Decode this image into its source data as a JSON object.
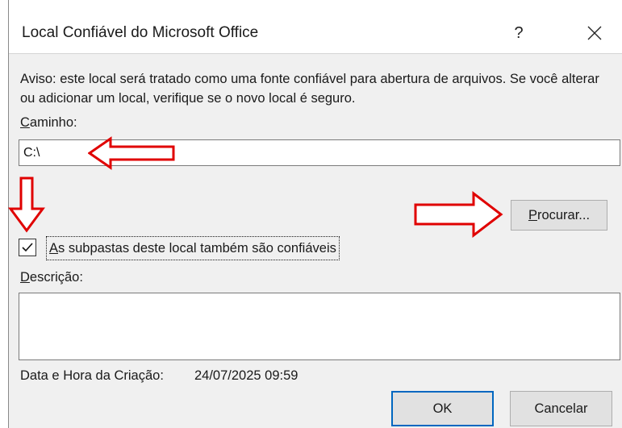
{
  "window": {
    "title": "Local Confiável do Microsoft Office",
    "help_label": "?",
    "close_icon": "close-icon"
  },
  "warning": {
    "text": "Aviso: este local será tratado como uma fonte confiável para abertura de arquivos. Se você alterar ou adicionar um local, verifique se o novo local é seguro."
  },
  "path": {
    "label_access_key": "C",
    "label_rest": "aminho:",
    "value": "C:\\"
  },
  "browse": {
    "access_key": "P",
    "label_rest": "rocurar..."
  },
  "subfolders": {
    "checked": true,
    "access_key": "A",
    "label_rest": "s subpastas deste local também são confiáveis"
  },
  "description": {
    "label_access_key": "D",
    "label_rest": "escrição:",
    "value": ""
  },
  "created": {
    "label": "Data e Hora da Criação:",
    "value": "24/07/2025 09:59"
  },
  "buttons": {
    "ok": "OK",
    "cancel": "Cancelar"
  },
  "colors": {
    "annotation_arrow": "#e00000",
    "default_button_border": "#0067c0",
    "dialog_background": "#f0f0f0"
  }
}
